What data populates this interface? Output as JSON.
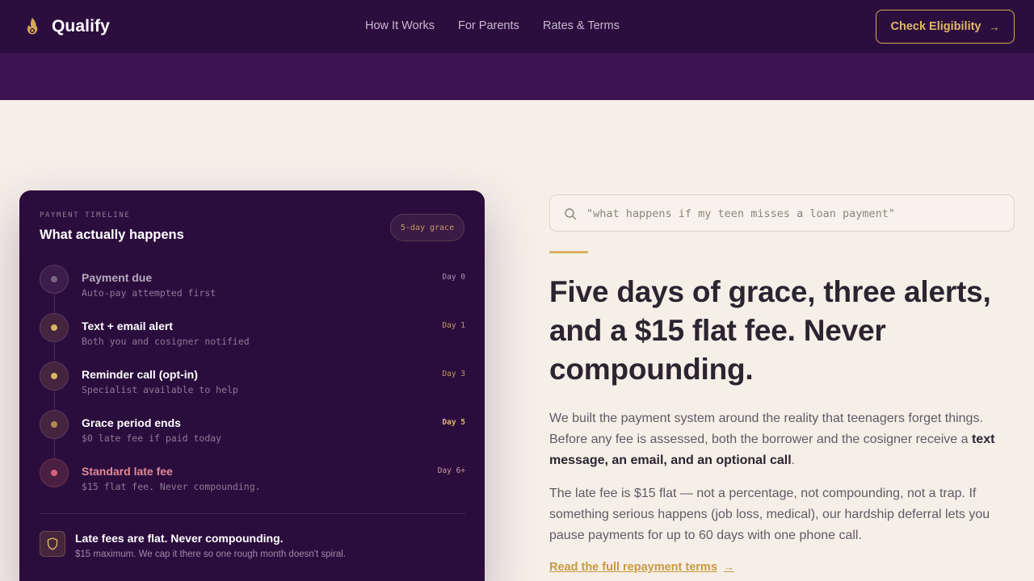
{
  "header": {
    "brand": "Qualify",
    "nav": [
      "How It Works",
      "For Parents",
      "Rates & Terms"
    ],
    "cta_label": "Check Eligibility",
    "cta_arrow": "→"
  },
  "card": {
    "eyebrow": "PAYMENT TIMELINE",
    "title": "What actually happens",
    "grace_badge": "5-day grace",
    "steps": [
      {
        "title": "Payment due",
        "sub": "Auto-pay attempted first",
        "day": "Day 0",
        "status": "muted"
      },
      {
        "title": "Text + email alert",
        "sub": "Both you and cosigner notified",
        "day": "Day 1",
        "status": "active"
      },
      {
        "title": "Reminder call (opt-in)",
        "sub": "Specialist available to help",
        "day": "Day 3",
        "status": "active"
      },
      {
        "title": "Grace period ends",
        "sub": "$0 late fee if paid today",
        "day": "Day 5",
        "status": "warning"
      },
      {
        "title": "Standard late fee",
        "sub": "$15 flat fee. Never compounding.",
        "day": "Day 6+",
        "status": "alert"
      }
    ],
    "note_title": "Late fees are flat. Never compounding.",
    "note_sub": "$15 maximum. We cap it there so one rough month doesn't spiral."
  },
  "content": {
    "search_query": "\"what happens if my teen misses a loan payment\"",
    "headline": "Five days of grace, three alerts, and a $15 flat fee. Never compounding.",
    "p1_a": "We built the payment system around the reality that teenagers forget things. Before any fee is assessed, both the borrower and the cosigner receive a ",
    "p1_strong": "text message, an email, and an optional call",
    "p1_end": ".",
    "p2": "The late fee is $15 flat — not a percentage, not compounding, not a trap. If something serious happens (job loss, medical), our hardship deferral lets you pause payments for up to 60 days with one phone call.",
    "read_link": "Read the full repayment terms",
    "read_arrow": "→"
  },
  "colors": {
    "header_bg": "#2c0e3e",
    "band_bg": "#3d1452",
    "page_bg": "#f5efe8",
    "accent_gold": "#d4a855",
    "card_bg": "#2b0d3d",
    "alert_pink": "#d97a8a"
  },
  "icons": {
    "logo": "flame-icon",
    "search": "search-icon",
    "note": "shield-icon"
  }
}
